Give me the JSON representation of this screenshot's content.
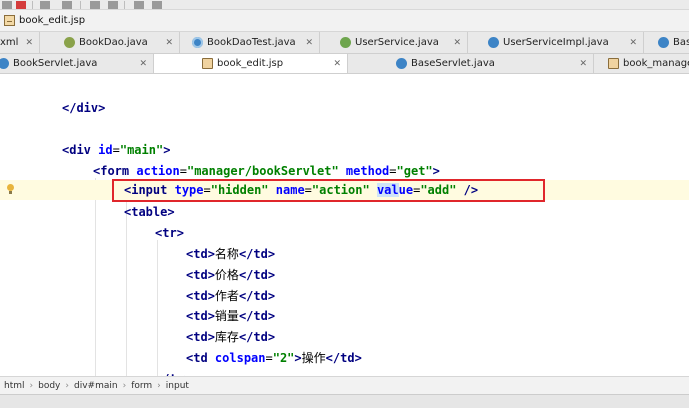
{
  "navigation": {
    "file": "book_edit.jsp"
  },
  "tabs_row1": [
    {
      "label": "xml",
      "icon": "xml-file-icon"
    },
    {
      "label": "BookDao.java",
      "icon": "java-class-icon"
    },
    {
      "label": "BookDaoTest.java",
      "icon": "test-class-icon"
    },
    {
      "label": "UserService.java",
      "icon": "interface-icon"
    },
    {
      "label": "UserServiceImpl.java",
      "icon": "java-class-icon"
    },
    {
      "label": "Bas",
      "icon": "java-class-icon"
    }
  ],
  "tabs_row2": [
    {
      "label": "BookServlet.java",
      "icon": "java-class-icon"
    },
    {
      "label": "book_edit.jsp",
      "icon": "jsp-file-icon",
      "active": true
    },
    {
      "label": "BaseServlet.java",
      "icon": "java-class-icon"
    },
    {
      "label": "book_manager.",
      "icon": "jsp-file-icon"
    }
  ],
  "code": {
    "l1": {
      "open": "</",
      "name": "div",
      "close": ">"
    },
    "l2": {
      "open": "<",
      "name": "div",
      "a1": "id",
      "eq": "=",
      "v1": "\"main\"",
      "close": ">"
    },
    "l3": {
      "open": "<",
      "name": "form",
      "a1": "action",
      "eq": "=",
      "v1": "\"manager/bookServlet\"",
      "a2": "method",
      "v2": "\"get\"",
      "close": ">"
    },
    "l4": {
      "open": "<",
      "name": "input",
      "a1": "type",
      "eq": "=",
      "v1": "\"hidden\"",
      "a2": "name",
      "v2": "\"action\"",
      "a3a": "val",
      "a3b": "ue",
      "v3": "\"add\"",
      "close": " />"
    },
    "l5": {
      "open": "<",
      "name": "table",
      "close": ">"
    },
    "l6": {
      "open": "<",
      "name": "tr",
      "close": ">"
    },
    "rows": [
      {
        "text": "名称"
      },
      {
        "text": "价格"
      },
      {
        "text": "作者"
      },
      {
        "text": "销量"
      },
      {
        "text": "库存"
      }
    ],
    "td_tag": "td",
    "l12": {
      "a1": "colspan",
      "v1": "\"2\"",
      "text": "操作"
    },
    "l13": {
      "open": "</",
      "name": "tr",
      "close": ">"
    }
  },
  "breadcrumb": [
    "html",
    "body",
    "div#main",
    "form",
    "input"
  ],
  "highlight_color": "#e0262b"
}
